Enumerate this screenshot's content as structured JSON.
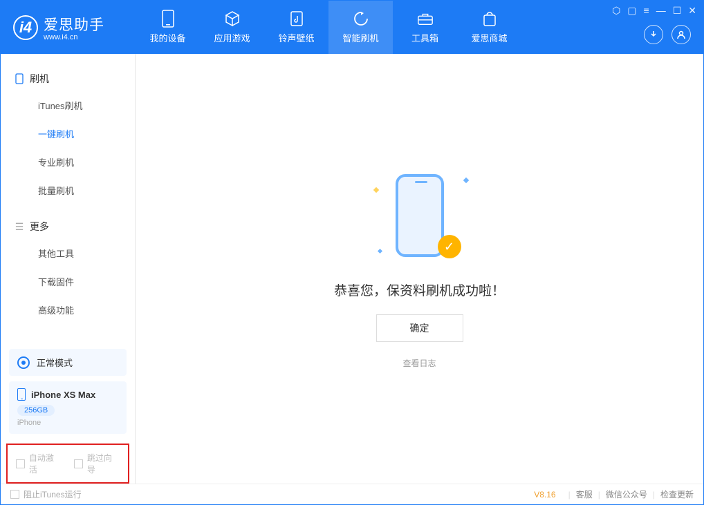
{
  "app": {
    "name": "爱思助手",
    "site": "www.i4.cn"
  },
  "titlebar_icons": [
    "shirt",
    "scan",
    "list",
    "minimize",
    "maximize",
    "close"
  ],
  "tabs": [
    {
      "id": "device",
      "label": "我的设备"
    },
    {
      "id": "apps",
      "label": "应用游戏"
    },
    {
      "id": "ring",
      "label": "铃声壁纸"
    },
    {
      "id": "flash",
      "label": "智能刷机",
      "active": true
    },
    {
      "id": "tools",
      "label": "工具箱"
    },
    {
      "id": "store",
      "label": "爱思商城"
    }
  ],
  "sidebar": {
    "group1": {
      "title": "刷机",
      "items": [
        {
          "label": "iTunes刷机"
        },
        {
          "label": "一键刷机",
          "active": true
        },
        {
          "label": "专业刷机"
        },
        {
          "label": "批量刷机"
        }
      ]
    },
    "group2": {
      "title": "更多",
      "items": [
        {
          "label": "其他工具"
        },
        {
          "label": "下载固件"
        },
        {
          "label": "高级功能"
        }
      ]
    }
  },
  "device": {
    "mode": "正常模式",
    "name": "iPhone XS Max",
    "storage": "256GB",
    "type": "iPhone"
  },
  "options": {
    "auto_activate": "自动激活",
    "skip_guide": "跳过向导"
  },
  "main": {
    "success_text": "恭喜您，保资料刷机成功啦！",
    "ok_label": "确定",
    "log_link": "查看日志"
  },
  "footer": {
    "block_itunes": "阻止iTunes运行",
    "version": "V8.16",
    "links": [
      "客服",
      "微信公众号",
      "检查更新"
    ]
  }
}
